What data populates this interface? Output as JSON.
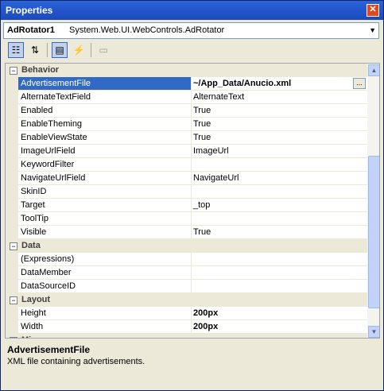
{
  "window": {
    "title": "Properties",
    "close_label": "✕"
  },
  "object_selector": {
    "name": "AdRotator1",
    "type": "System.Web.UI.WebControls.AdRotator"
  },
  "categories": [
    {
      "name": "Behavior",
      "toggle": "⊟"
    },
    {
      "name": "Data",
      "toggle": "⊟"
    },
    {
      "name": "Layout",
      "toggle": "⊟"
    },
    {
      "name": "Mi",
      "toggle": "⊟"
    }
  ],
  "properties": {
    "behavior": [
      {
        "name": "AdvertisementFile",
        "value": "~/App_Data/Anucio.xml"
      },
      {
        "name": "AlternateTextField",
        "value": "AlternateText"
      },
      {
        "name": "Enabled",
        "value": "True"
      },
      {
        "name": "EnableTheming",
        "value": "True"
      },
      {
        "name": "EnableViewState",
        "value": "True"
      },
      {
        "name": "ImageUrlField",
        "value": "ImageUrl"
      },
      {
        "name": "KeywordFilter",
        "value": ""
      },
      {
        "name": "NavigateUrlField",
        "value": "NavigateUrl"
      },
      {
        "name": "SkinID",
        "value": ""
      },
      {
        "name": "Target",
        "value": "_top"
      },
      {
        "name": "ToolTip",
        "value": ""
      },
      {
        "name": "Visible",
        "value": "True"
      }
    ],
    "data": [
      {
        "name": "(Expressions)",
        "value": ""
      },
      {
        "name": "DataMember",
        "value": ""
      },
      {
        "name": "DataSourceID",
        "value": ""
      }
    ],
    "layout": [
      {
        "name": "Height",
        "value": "200px"
      },
      {
        "name": "Width",
        "value": "200px"
      }
    ]
  },
  "description": {
    "title": "AdvertisementFile",
    "text": "XML file containing advertisements."
  },
  "colors": {
    "title_bar": "#2a63d8",
    "selection": "#316ac5",
    "panel": "#ece9d8"
  }
}
